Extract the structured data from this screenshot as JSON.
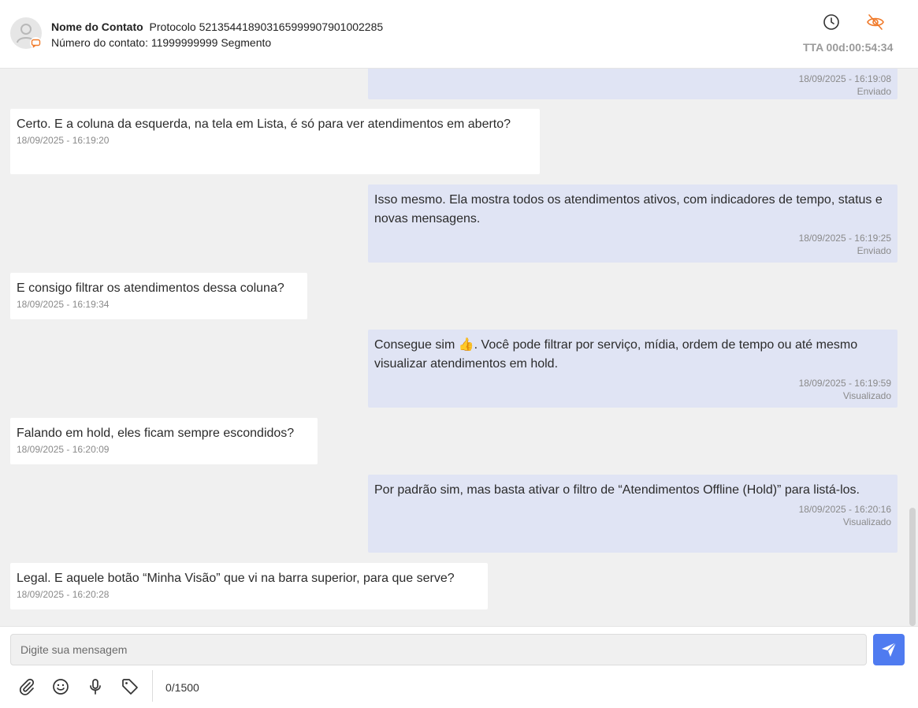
{
  "header": {
    "contact_name": "Nome do Contato",
    "protocol": "Protocolo 52135441890316599990790100228",
    "protocol_suffix": "5",
    "contact_number": "Número do contato: 11999999999 Segmento",
    "tta": "TTA 00d:00:54:34",
    "icons": [
      "user-avatar-icon",
      "chat-badge-icon",
      "clock-icon",
      "eye-off-icon"
    ],
    "accent_color": "#f07a2a"
  },
  "messages": [
    {
      "direction": "out",
      "text": "",
      "time": "18/09/2025 - 16:19:08",
      "status": "Enviado"
    },
    {
      "direction": "in",
      "text": "Certo. E a coluna da esquerda, na tela em Lista, é só para ver atendimentos em aberto?",
      "time": "18/09/2025 - 16:19:20"
    },
    {
      "direction": "out",
      "text": "Isso mesmo. Ela mostra todos os atendimentos ativos, com indicadores de tempo, status e novas mensagens.",
      "time": "18/09/2025 - 16:19:25",
      "status": "Enviado"
    },
    {
      "direction": "in",
      "text": "E consigo filtrar os atendimentos dessa coluna?",
      "time": "18/09/2025 - 16:19:34"
    },
    {
      "direction": "out",
      "text": "Consegue sim 👍. Você pode filtrar por serviço, mídia, ordem de tempo ou até mesmo visualizar atendimentos em hold.",
      "time": "18/09/2025 - 16:19:59",
      "status": "Visualizado"
    },
    {
      "direction": "in",
      "text": "Falando em hold, eles ficam sempre escondidos?",
      "time": "18/09/2025 - 16:20:09"
    },
    {
      "direction": "out",
      "text": "Por padrão sim, mas basta ativar o filtro de “Atendimentos Offline (Hold)” para listá-los.",
      "time": "18/09/2025 - 16:20:16",
      "status": "Visualizado"
    },
    {
      "direction": "in",
      "text": "Legal. E aquele botão “Minha Visão” que vi na barra superior, para que serve?",
      "time": "18/09/2025 - 16:20:28"
    }
  ],
  "composer": {
    "placeholder": "Digite sua mensagem",
    "counter": "0/1500",
    "send_color": "#4f7bf0",
    "icons": [
      "paperclip-icon",
      "emoji-icon",
      "microphone-icon",
      "tag-icon",
      "send-icon"
    ]
  }
}
